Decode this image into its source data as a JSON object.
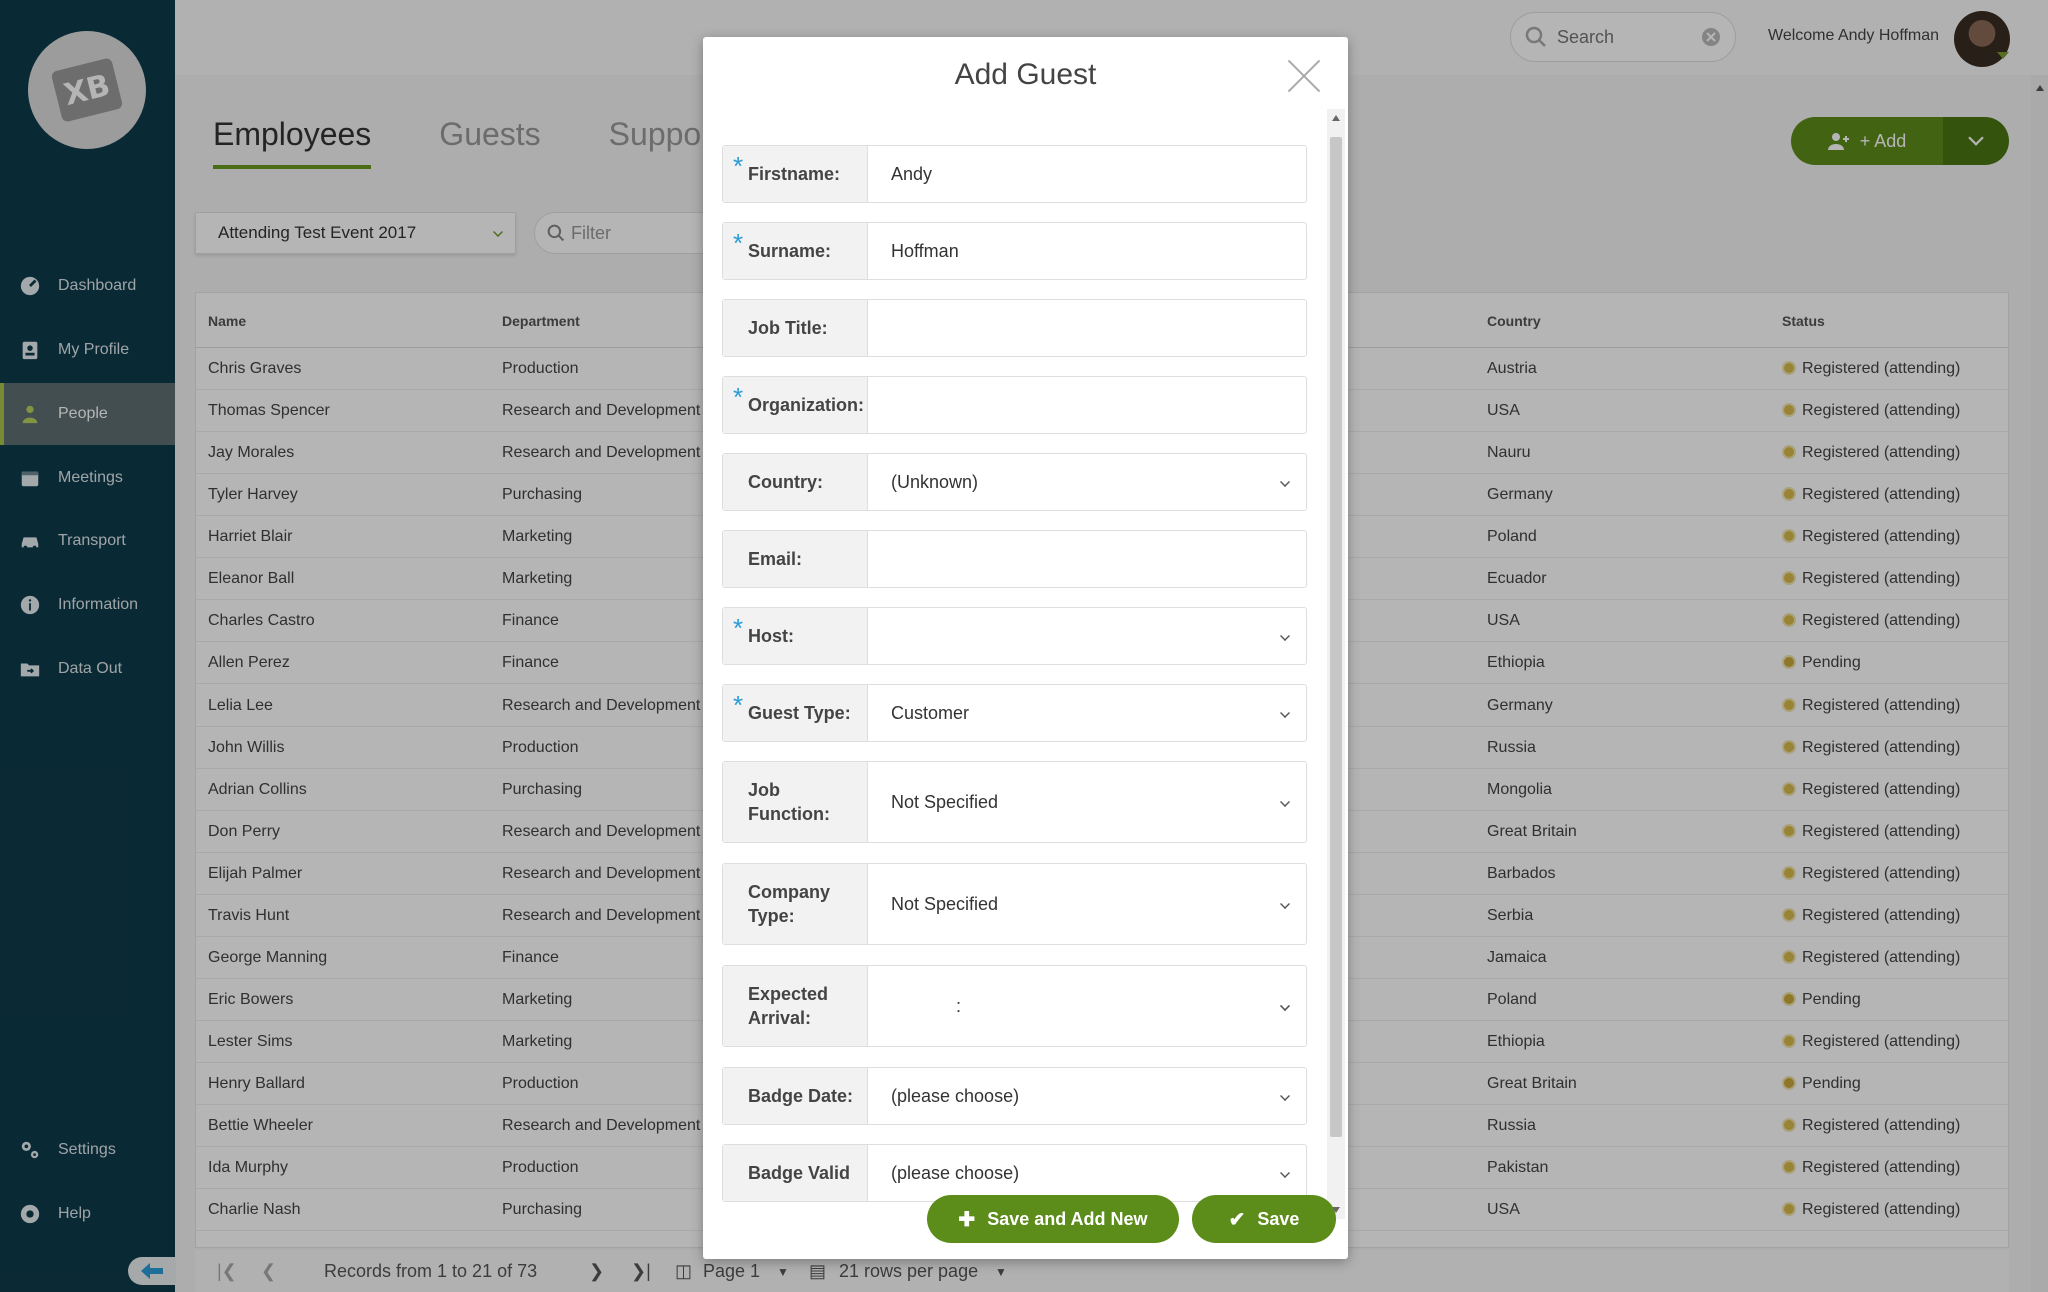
{
  "logo": {
    "text": "XB"
  },
  "nav": [
    {
      "label": "Dashboard",
      "icon": "dashboard-icon"
    },
    {
      "label": "My Profile",
      "icon": "profile-icon"
    },
    {
      "label": "People",
      "icon": "people-icon",
      "active": true
    },
    {
      "label": "Meetings",
      "icon": "calendar-icon"
    },
    {
      "label": "Transport",
      "icon": "car-icon"
    },
    {
      "label": "Information",
      "icon": "info-icon"
    },
    {
      "label": "Data Out",
      "icon": "folder-export-icon"
    }
  ],
  "nav_bottom": [
    {
      "label": "Settings",
      "icon": "settings-icon"
    },
    {
      "label": "Help",
      "icon": "help-icon"
    }
  ],
  "header": {
    "search_placeholder": "Search",
    "welcome": "Welcome Andy Hoffman"
  },
  "tabs": [
    "Employees",
    "Guests",
    "Support"
  ],
  "add_button": "+ Add",
  "event_filter": "Attending Test Event 2017",
  "filter_placeholder": "Filter",
  "table": {
    "columns": {
      "name": "Name",
      "department": "Department",
      "country": "Country",
      "status": "Status"
    },
    "rows": [
      {
        "name": "Chris Graves",
        "department": "Production",
        "country": "Austria",
        "status": "Registered (attending)"
      },
      {
        "name": "Thomas Spencer",
        "department": "Research and Development",
        "country": "USA",
        "status": "Registered (attending)"
      },
      {
        "name": "Jay Morales",
        "department": "Research and Development",
        "country": "Nauru",
        "status": "Registered (attending)"
      },
      {
        "name": "Tyler Harvey",
        "department": "Purchasing",
        "country": "Germany",
        "status": "Registered (attending)"
      },
      {
        "name": "Harriet Blair",
        "department": "Marketing",
        "country": "Poland",
        "status": "Registered (attending)"
      },
      {
        "name": "Eleanor Ball",
        "department": "Marketing",
        "country": "Ecuador",
        "status": "Registered (attending)"
      },
      {
        "name": "Charles Castro",
        "department": "Finance",
        "country": "USA",
        "status": "Registered (attending)"
      },
      {
        "name": "Allen Perez",
        "department": "Finance",
        "country": "Ethiopia",
        "status": "Pending"
      },
      {
        "name": "Lelia Lee",
        "department": "Research and Development",
        "country": "Germany",
        "status": "Registered (attending)"
      },
      {
        "name": "John Willis",
        "department": "Production",
        "country": "Russia",
        "status": "Registered (attending)"
      },
      {
        "name": "Adrian Collins",
        "department": "Purchasing",
        "country": "Mongolia",
        "status": "Registered (attending)"
      },
      {
        "name": "Don Perry",
        "department": "Research and Development",
        "country": "Great Britain",
        "status": "Registered (attending)"
      },
      {
        "name": "Elijah Palmer",
        "department": "Research and Development",
        "country": "Barbados",
        "status": "Registered (attending)"
      },
      {
        "name": "Travis Hunt",
        "department": "Research and Development",
        "country": "Serbia",
        "status": "Registered (attending)"
      },
      {
        "name": "George Manning",
        "department": "Finance",
        "country": "Jamaica",
        "status": "Registered (attending)"
      },
      {
        "name": "Eric Bowers",
        "department": "Marketing",
        "country": "Poland",
        "status": "Pending"
      },
      {
        "name": "Lester Sims",
        "department": "Marketing",
        "country": "Ethiopia",
        "status": "Registered (attending)"
      },
      {
        "name": "Henry Ballard",
        "department": "Production",
        "country": "Great Britain",
        "status": "Pending"
      },
      {
        "name": "Bettie Wheeler",
        "department": "Research and Development",
        "country": "Russia",
        "status": "Registered (attending)"
      },
      {
        "name": "Ida Murphy",
        "department": "Production",
        "country": "Pakistan",
        "status": "Registered (attending)"
      },
      {
        "name": "Charlie Nash",
        "department": "Purchasing",
        "country": "USA",
        "status": "Registered (attending)"
      }
    ]
  },
  "pager": {
    "records": "Records from 1 to 21 of 73",
    "page": "Page 1",
    "rows_per_page": "21 rows per page"
  },
  "modal": {
    "title": "Add Guest",
    "fields": [
      {
        "label": "Firstname:",
        "value": "Andy",
        "required": true,
        "type": "text"
      },
      {
        "label": "Surname:",
        "value": "Hoffman",
        "required": true,
        "type": "text"
      },
      {
        "label": "Job Title:",
        "value": "",
        "required": false,
        "type": "text"
      },
      {
        "label": "Organization:",
        "value": "",
        "required": true,
        "type": "text"
      },
      {
        "label": "Country:",
        "value": "(Unknown)",
        "required": false,
        "type": "select"
      },
      {
        "label": "Email:",
        "value": "",
        "required": false,
        "type": "text"
      },
      {
        "label": "Host:",
        "value": "",
        "required": true,
        "type": "select"
      },
      {
        "label": "Guest Type:",
        "value": "Customer",
        "required": true,
        "type": "select"
      },
      {
        "label": "Job Function:",
        "value": "Not Specified",
        "required": false,
        "type": "select"
      },
      {
        "label": "Company Type:",
        "value": "Not Specified",
        "required": false,
        "type": "select"
      },
      {
        "label": "Expected Arrival:",
        "value": ":",
        "required": false,
        "type": "time"
      },
      {
        "label": "Badge Date:",
        "value": "(please choose)",
        "required": false,
        "type": "select"
      },
      {
        "label": "Badge Valid",
        "value": "(please choose)",
        "required": false,
        "type": "select"
      }
    ],
    "save_new_label": "Save and Add New",
    "save_label": "Save"
  },
  "colors": {
    "sidebar": "#0e3a4b",
    "accent_green": "#5c8c1a",
    "required_star": "#2a9bd6",
    "status_dot": "#d8b94a"
  }
}
